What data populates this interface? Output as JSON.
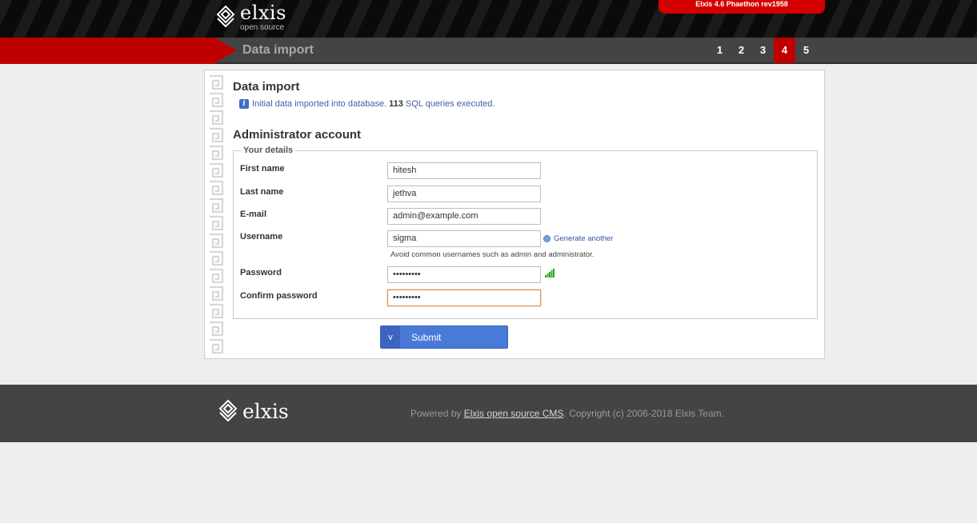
{
  "header": {
    "logo_name": "elxis",
    "logo_sub": "open source",
    "version": "Elxis 4.6 Phaethon rev1958"
  },
  "stepbar": {
    "title": "Data import",
    "steps": [
      "1",
      "2",
      "3",
      "4",
      "5"
    ],
    "active_step": "4"
  },
  "data_import": {
    "title": "Data import",
    "info_prefix": "Initial data imported into database.",
    "query_count": "113",
    "info_suffix": "SQL queries executed."
  },
  "admin": {
    "title": "Administrator account",
    "legend": "Your details",
    "first_name_label": "First name",
    "first_name_value": "hitesh",
    "last_name_label": "Last name",
    "last_name_value": "jethva",
    "email_label": "E-mail",
    "email_value": "admin@example.com",
    "username_label": "Username",
    "username_value": "sigma",
    "generate_label": "Generate another",
    "username_hint": "Avoid common usernames such as admin and administrator.",
    "password_label": "Password",
    "password_value": "•••••••••",
    "confirm_label": "Confirm password",
    "confirm_value": "•••••••••"
  },
  "submit": {
    "chevron": "v",
    "label": "Submit"
  },
  "footer": {
    "logo_name": "elxis",
    "powered_prefix": "Powered by",
    "powered_link": "Elxis open source CMS",
    "powered_suffix": ". Copyright (c) 2006-2018 Elxis Team."
  },
  "colors": {
    "brand_red": "#c00000",
    "button_blue": "#4a7ad8",
    "info_blue": "#4a5aa8"
  }
}
